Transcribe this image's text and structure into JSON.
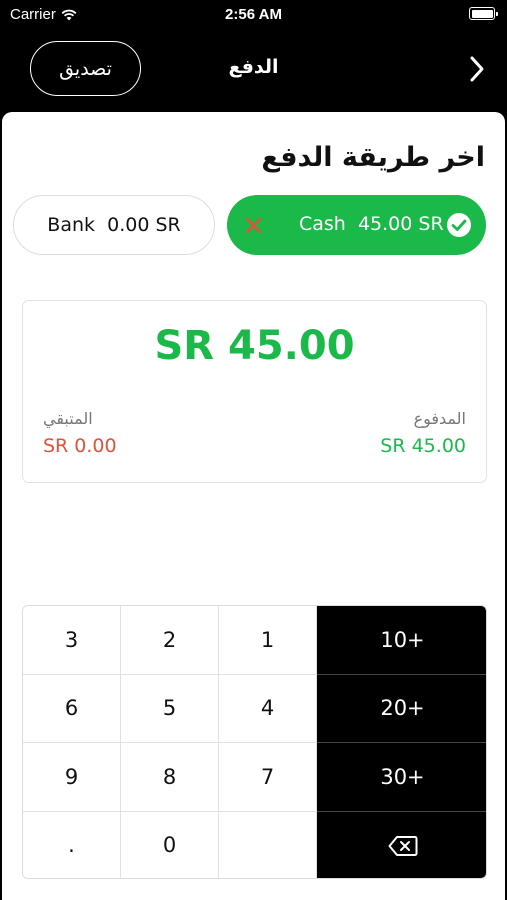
{
  "status_bar": {
    "carrier": "Carrier",
    "time": "2:56 AM"
  },
  "nav": {
    "title": "الدفع",
    "confirm_label": "تصديق",
    "chevron_icon": "chevron-right-icon"
  },
  "payment": {
    "section_title": "اخر طريقة الدفع",
    "methods": [
      {
        "name": "Cash",
        "amount": "45.00 SR",
        "selected": true
      },
      {
        "name": "Bank",
        "amount": "0.00 SR",
        "selected": false
      }
    ],
    "total": "SR 45.00",
    "remaining_label": "المتبقي",
    "remaining_value": "SR 0.00",
    "paid_label": "المدفوع",
    "paid_value": "SR 45.00"
  },
  "keypad": {
    "rows": [
      [
        "3",
        "2",
        "1",
        "10+"
      ],
      [
        "6",
        "5",
        "4",
        "20+"
      ],
      [
        "9",
        "8",
        "7",
        "30+"
      ],
      [
        ".",
        "0",
        "",
        "backspace-icon"
      ]
    ]
  },
  "colors": {
    "accent_green": "#1bb84a",
    "remaining_red": "#e0533a",
    "nav_bg": "#000000"
  }
}
